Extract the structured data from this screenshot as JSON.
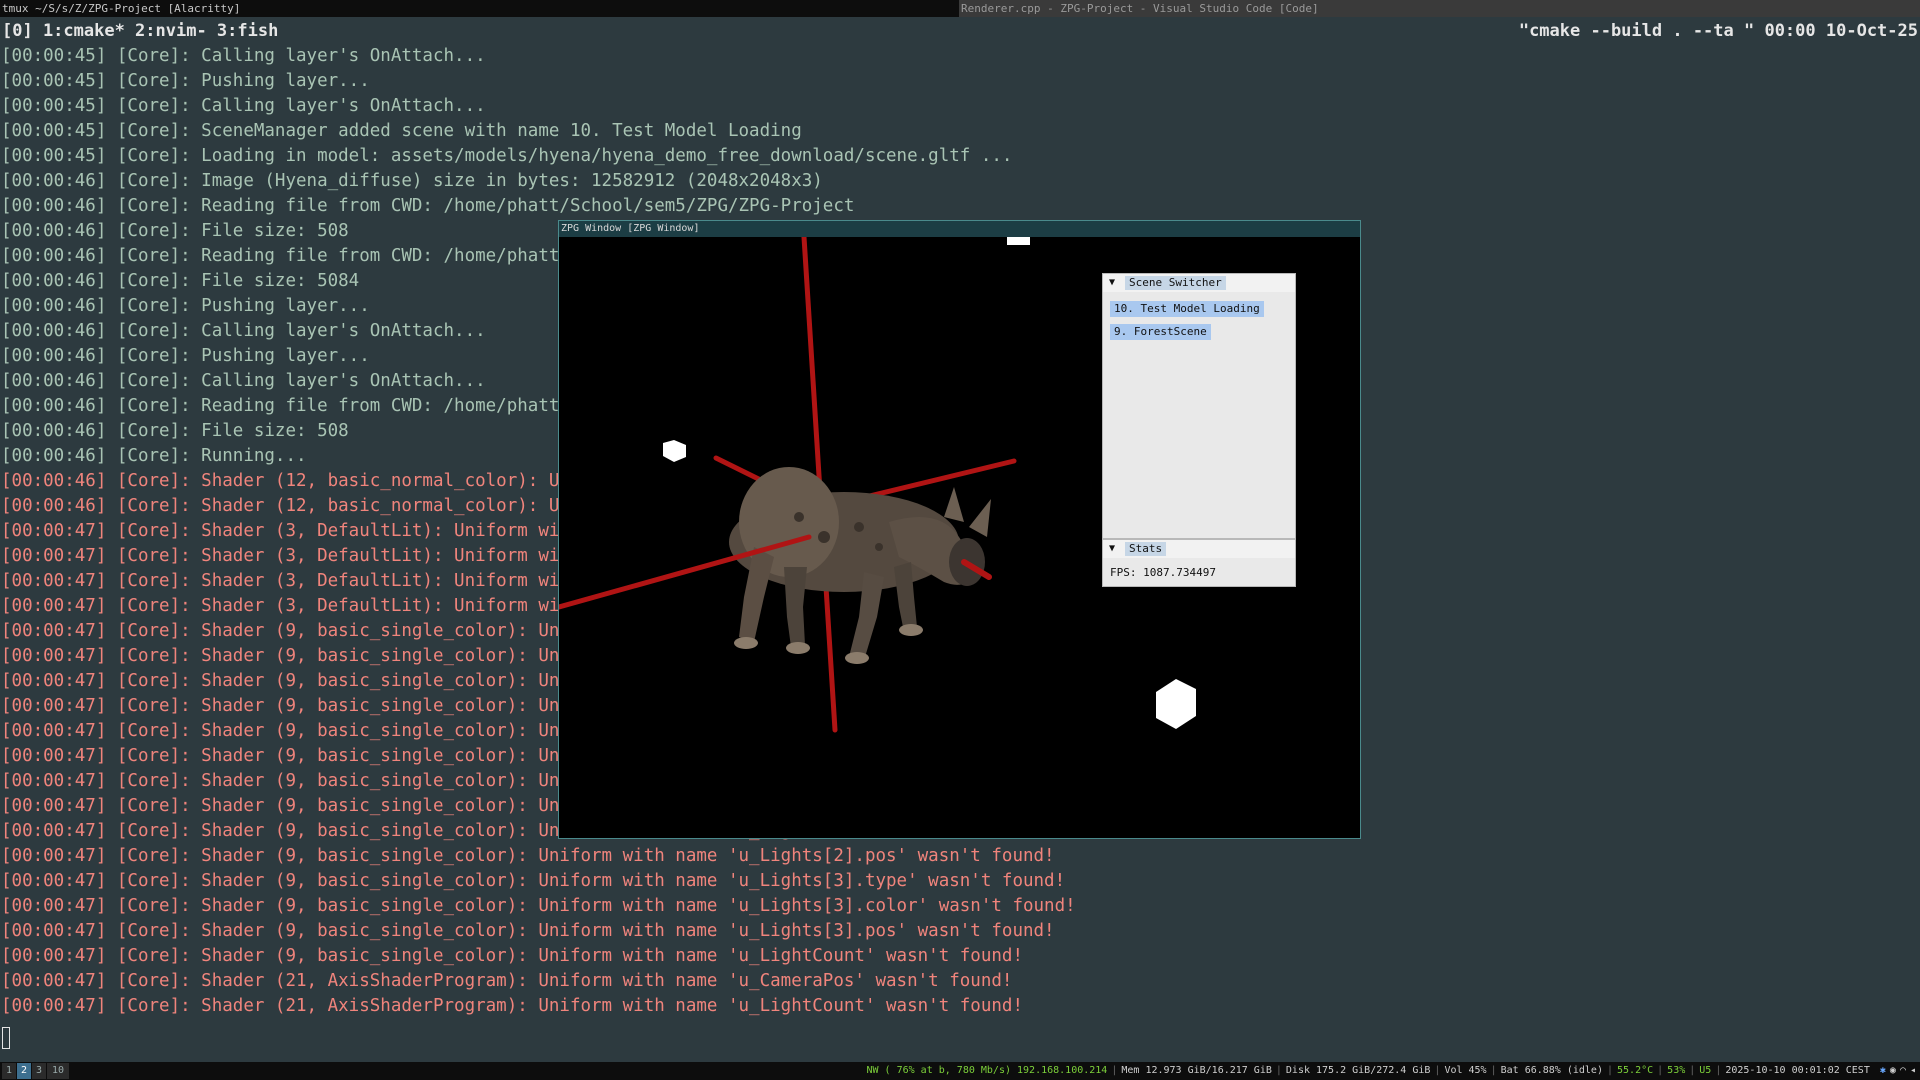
{
  "topbar": {
    "left_title": "tmux ~/S/s/Z/ZPG-Project [Alacritty]",
    "right_title": "Renderer.cpp - ZPG-Project - Visual Studio Code [Code]"
  },
  "tmux": {
    "windows": "[0] 1:cmake* 2:nvim- 3:fish",
    "right": "\"cmake --build . --ta \" 00:00 10-Oct-25"
  },
  "log": [
    {
      "text": "[00:00:45] [Core]: Calling layer's OnAttach...",
      "level": "info"
    },
    {
      "text": "[00:00:45] [Core]: Pushing layer...",
      "level": "info"
    },
    {
      "text": "[00:00:45] [Core]: Calling layer's OnAttach...",
      "level": "info"
    },
    {
      "text": "[00:00:45] [Core]: SceneManager added scene with name 10. Test Model Loading",
      "level": "info"
    },
    {
      "text": "[00:00:45] [Core]: Loading in model: assets/models/hyena/hyena_demo_free_download/scene.gltf ...",
      "level": "info"
    },
    {
      "text": "[00:00:46] [Core]: Image (Hyena_diffuse) size in bytes: 12582912 (2048x2048x3)",
      "level": "info"
    },
    {
      "text": "[00:00:46] [Core]: Reading file from CWD: /home/phatt/School/sem5/ZPG/ZPG-Project",
      "level": "info"
    },
    {
      "text": "[00:00:46] [Core]: File size: 508",
      "level": "info"
    },
    {
      "text": "[00:00:46] [Core]: Reading file from CWD: /home/phatt/School/s",
      "level": "info"
    },
    {
      "text": "[00:00:46] [Core]: File size: 5084",
      "level": "info"
    },
    {
      "text": "[00:00:46] [Core]: Pushing layer...",
      "level": "info"
    },
    {
      "text": "[00:00:46] [Core]: Calling layer's OnAttach...",
      "level": "info"
    },
    {
      "text": "[00:00:46] [Core]: Pushing layer...",
      "level": "info"
    },
    {
      "text": "[00:00:46] [Core]: Calling layer's OnAttach...",
      "level": "info"
    },
    {
      "text": "[00:00:46] [Core]: Reading file from CWD: /home/phatt/School/s",
      "level": "info"
    },
    {
      "text": "[00:00:46] [Core]: File size: 508",
      "level": "info"
    },
    {
      "text": "[00:00:46] [Core]: Running...",
      "level": "info"
    },
    {
      "text": "[00:00:46] [Core]: Shader (12, basic_normal_color): Uniform wi",
      "level": "err"
    },
    {
      "text": "[00:00:46] [Core]: Shader (12, basic_normal_color): Uniform wi",
      "level": "err"
    },
    {
      "text": "[00:00:47] [Core]: Shader (3, DefaultLit): Uniform with name '",
      "level": "err"
    },
    {
      "text": "[00:00:47] [Core]: Shader (3, DefaultLit): Uniform with name '",
      "level": "err"
    },
    {
      "text": "[00:00:47] [Core]: Shader (3, DefaultLit): Uniform with name '",
      "level": "err"
    },
    {
      "text": "[00:00:47] [Core]: Shader (3, DefaultLit): Uniform with name '",
      "level": "err"
    },
    {
      "text": "[00:00:47] [Core]: Shader (9, basic_single_color): Uniform wit",
      "level": "err"
    },
    {
      "text": "[00:00:47] [Core]: Shader (9, basic_single_color): Uniform wit",
      "level": "err"
    },
    {
      "text": "[00:00:47] [Core]: Shader (9, basic_single_color): Uniform wit",
      "level": "err"
    },
    {
      "text": "[00:00:47] [Core]: Shader (9, basic_single_color): Uniform wit",
      "level": "err"
    },
    {
      "text": "[00:00:47] [Core]: Shader (9, basic_single_color): Uniform wit",
      "level": "err"
    },
    {
      "text": "[00:00:47] [Core]: Shader (9, basic_single_color): Uniform wit",
      "level": "err"
    },
    {
      "text": "[00:00:47] [Core]: Shader (9, basic_single_color): Uniform wit",
      "level": "err"
    },
    {
      "text": "[00:00:47] [Core]: Shader (9, basic_single_color): Uniform wit",
      "level": "err"
    },
    {
      "text": "[00:00:47] [Core]: Shader (9, basic_single_color): Uniform with name 'u_Lights[2].color' wasn't found!",
      "level": "err"
    },
    {
      "text": "[00:00:47] [Core]: Shader (9, basic_single_color): Uniform with name 'u_Lights[2].pos' wasn't found!",
      "level": "err"
    },
    {
      "text": "[00:00:47] [Core]: Shader (9, basic_single_color): Uniform with name 'u_Lights[3].type' wasn't found!",
      "level": "err"
    },
    {
      "text": "[00:00:47] [Core]: Shader (9, basic_single_color): Uniform with name 'u_Lights[3].color' wasn't found!",
      "level": "err"
    },
    {
      "text": "[00:00:47] [Core]: Shader (9, basic_single_color): Uniform with name 'u_Lights[3].pos' wasn't found!",
      "level": "err"
    },
    {
      "text": "[00:00:47] [Core]: Shader (9, basic_single_color): Uniform with name 'u_LightCount' wasn't found!",
      "level": "err"
    },
    {
      "text": "[00:00:47] [Core]: Shader (21, AxisShaderProgram): Uniform with name 'u_CameraPos' wasn't found!",
      "level": "err"
    },
    {
      "text": "[00:00:47] [Core]: Shader (21, AxisShaderProgram): Uniform with name 'u_LightCount' wasn't found!",
      "level": "err"
    }
  ],
  "zpg_window": {
    "title": "ZPG Window [ZPG Window]",
    "scene_switcher": {
      "title": "Scene Switcher",
      "items": [
        "10. Test Model Loading",
        "9. ForestScene"
      ]
    },
    "stats": {
      "title": "Stats",
      "fps": "FPS: 1087.734497"
    }
  },
  "statusbar": {
    "workspaces": [
      "1",
      "2",
      "3",
      "10"
    ],
    "active_workspace": "2",
    "net": "NW ( 76% at b, 780 Mb/s) 192.168.100.214",
    "mem": "Mem 12.973 GiB/16.217 GiB",
    "disk": "Disk 175.2 GiB/272.4 GiB",
    "vol": "Vol 45%",
    "bat": "Bat 66.88% (idle)",
    "temp": "55.2°C",
    "cpu": "53%",
    "us": "U5",
    "datetime": "2025-10-10 00:01:02 CEST"
  },
  "colors": {
    "terminal_bg": "#2d3a3f",
    "info_text": "#a9c4b4",
    "error_text": "#f0847c",
    "axis_red": "#b01414",
    "net_green": "#7ccf3a",
    "temp_green": "#7ccf3a"
  }
}
